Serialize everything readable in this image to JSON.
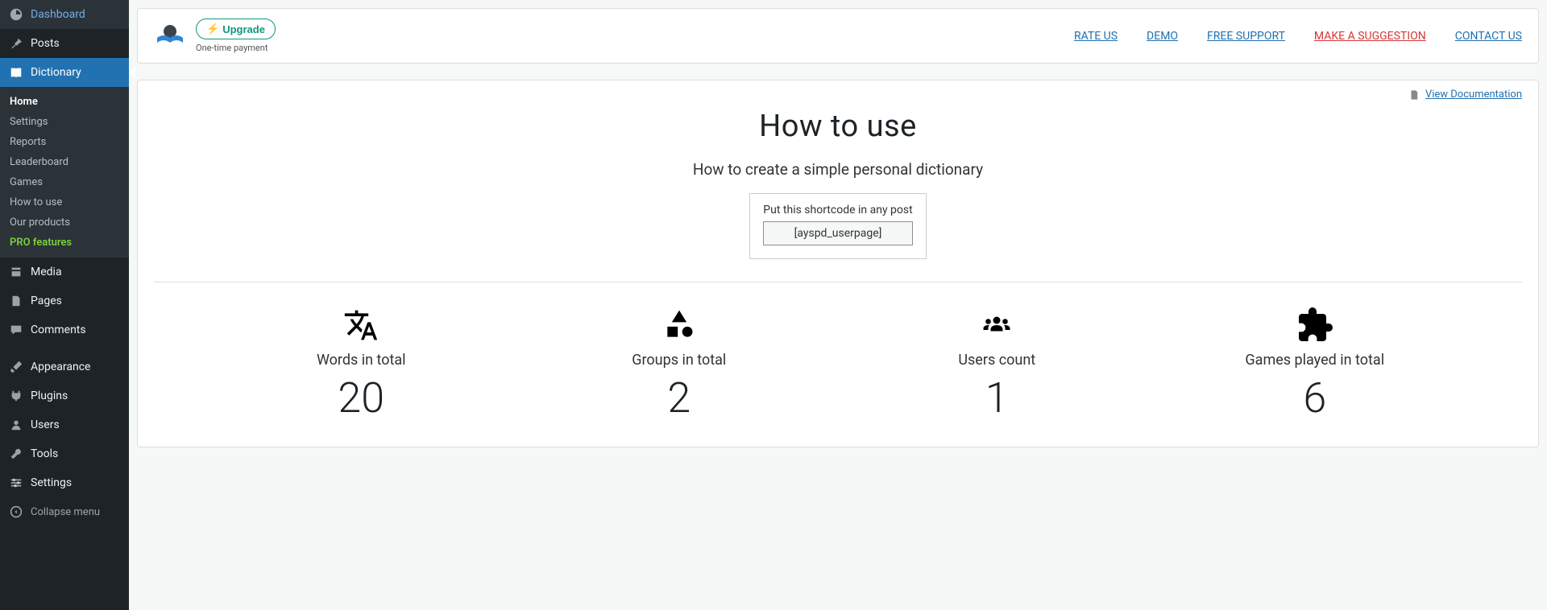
{
  "sidebar": {
    "items": [
      {
        "label": "Dashboard"
      },
      {
        "label": "Posts"
      },
      {
        "label": "Dictionary"
      },
      {
        "label": "Media"
      },
      {
        "label": "Pages"
      },
      {
        "label": "Comments"
      },
      {
        "label": "Appearance"
      },
      {
        "label": "Plugins"
      },
      {
        "label": "Users"
      },
      {
        "label": "Tools"
      },
      {
        "label": "Settings"
      }
    ],
    "submenu": [
      {
        "label": "Home"
      },
      {
        "label": "Settings"
      },
      {
        "label": "Reports"
      },
      {
        "label": "Leaderboard"
      },
      {
        "label": "Games"
      },
      {
        "label": "How to use"
      },
      {
        "label": "Our products"
      },
      {
        "label": "PRO features"
      }
    ],
    "collapse": "Collapse menu"
  },
  "header": {
    "upgrade": "Upgrade",
    "upgrade_sub": "One-time payment",
    "links": {
      "rate": "RATE US",
      "demo": "DEMO",
      "support": "FREE SUPPORT",
      "suggest": "MAKE A SUGGESTION",
      "contact": "CONTACT US"
    }
  },
  "content": {
    "doc_link": "View Documentation",
    "title": "How to use",
    "subtitle": "How to create a simple personal dictionary",
    "shortcode_label": "Put this shortcode in any post",
    "shortcode": "[ayspd_userpage]",
    "stats": [
      {
        "label": "Words in total",
        "value": "20"
      },
      {
        "label": "Groups in total",
        "value": "2"
      },
      {
        "label": "Users count",
        "value": "1"
      },
      {
        "label": "Games played in total",
        "value": "6"
      }
    ]
  }
}
